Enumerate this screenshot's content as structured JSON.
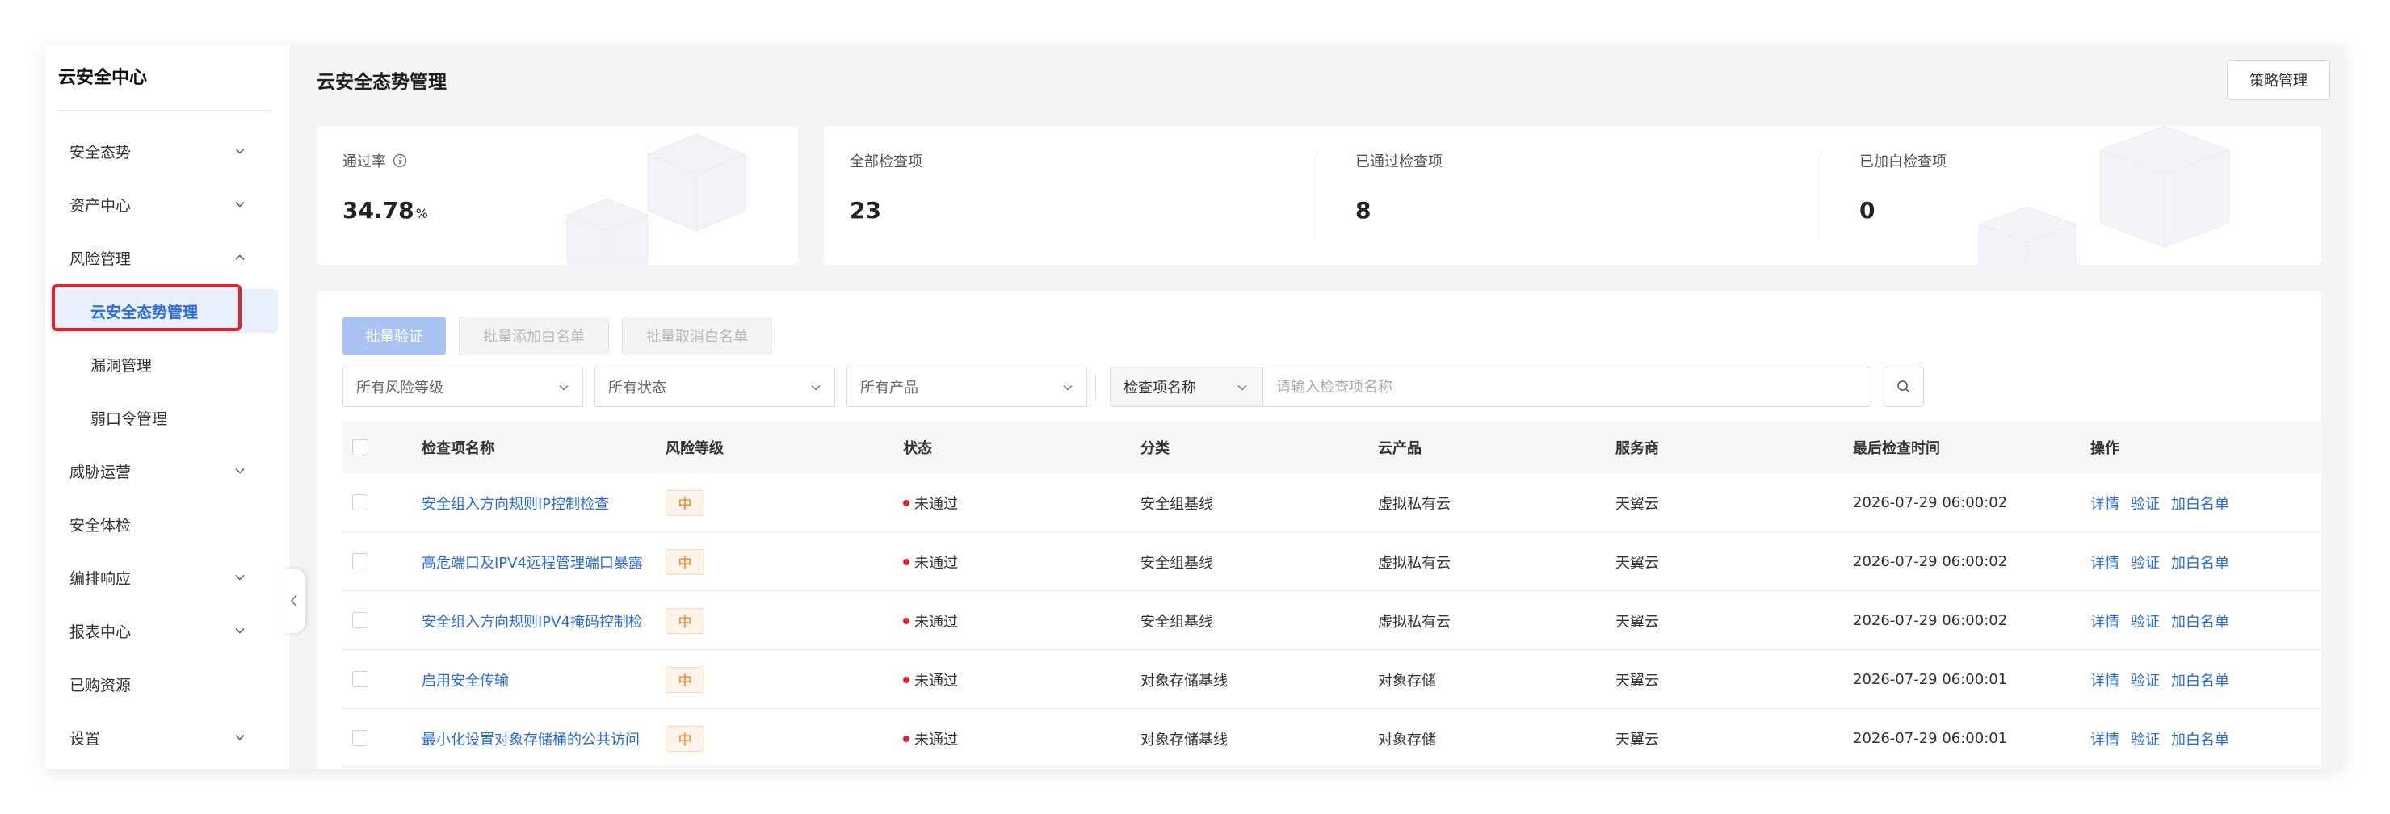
{
  "sidebar": {
    "title": "云安全中心",
    "items": [
      {
        "label": "安全态势",
        "chevron": "down"
      },
      {
        "label": "资产中心",
        "chevron": "down"
      },
      {
        "label": "风险管理",
        "chevron": "up"
      },
      {
        "label": "云安全态势管理",
        "sub": true,
        "active": true
      },
      {
        "label": "漏洞管理",
        "sub": true
      },
      {
        "label": "弱口令管理",
        "sub": true
      },
      {
        "label": "威胁运营",
        "chevron": "down"
      },
      {
        "label": "安全体检"
      },
      {
        "label": "编排响应",
        "chevron": "down"
      },
      {
        "label": "报表中心",
        "chevron": "down"
      },
      {
        "label": "已购资源"
      },
      {
        "label": "设置",
        "chevron": "down"
      }
    ]
  },
  "header": {
    "title": "云安全态势管理",
    "policy_button": "策略管理"
  },
  "stats": {
    "pass_rate_label": "通过率",
    "pass_rate_value": "34.78",
    "pass_rate_unit": "%",
    "all_checks_label": "全部检查项",
    "all_checks_value": "23",
    "passed_label": "已通过检查项",
    "passed_value": "8",
    "whitelisted_label": "已加白检查项",
    "whitelisted_value": "0"
  },
  "toolbar": {
    "batch_verify": "批量验证",
    "batch_add_whitelist": "批量添加白名单",
    "batch_remove_whitelist": "批量取消白名单"
  },
  "filters": {
    "risk_level": "所有风险等级",
    "status": "所有状态",
    "product": "所有产品",
    "search_type": "检查项名称",
    "search_placeholder": "请输入检查项名称"
  },
  "table": {
    "columns": [
      "检查项名称",
      "风险等级",
      "状态",
      "分类",
      "云产品",
      "服务商",
      "最后检查时间",
      "操作"
    ],
    "actions": [
      "详情",
      "验证",
      "加白名单"
    ],
    "rows": [
      {
        "name": "安全组入方向规则IP控制检查",
        "risk": "中",
        "status": "未通过",
        "category": "安全组基线",
        "product": "虚拟私有云",
        "provider": "天翼云",
        "time": "2026-07-29 06:00:02"
      },
      {
        "name": "高危端口及IPV4远程管理端口暴露",
        "risk": "中",
        "status": "未通过",
        "category": "安全组基线",
        "product": "虚拟私有云",
        "provider": "天翼云",
        "time": "2026-07-29 06:00:02"
      },
      {
        "name": "安全组入方向规则IPV4掩码控制检",
        "risk": "中",
        "status": "未通过",
        "category": "安全组基线",
        "product": "虚拟私有云",
        "provider": "天翼云",
        "time": "2026-07-29 06:00:02"
      },
      {
        "name": "启用安全传输",
        "risk": "中",
        "status": "未通过",
        "category": "对象存储基线",
        "product": "对象存储",
        "provider": "天翼云",
        "time": "2026-07-29 06:00:01"
      },
      {
        "name": "最小化设置对象存储桶的公共访问",
        "risk": "中",
        "status": "未通过",
        "category": "对象存储基线",
        "product": "对象存储",
        "provider": "天翼云",
        "time": "2026-07-29 06:00:01"
      }
    ]
  },
  "colors": {
    "accent": "#2a6be2",
    "danger": "#e5222b",
    "risk_medium": "#f07f1a"
  }
}
